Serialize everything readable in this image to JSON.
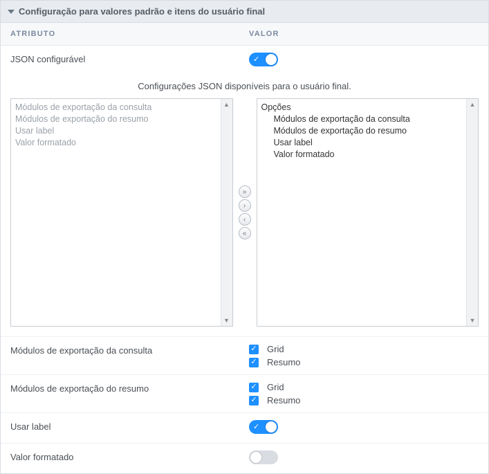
{
  "panel": {
    "title": "Configuração para valores padrão e itens do usuário final",
    "col_attr": "ATRIBUTO",
    "col_val": "VALOR"
  },
  "json_configurable": {
    "label": "JSON configurável",
    "checked": true
  },
  "caption": "Configurações JSON disponíveis para o usuário final.",
  "transfer": {
    "left": [
      "Módulos de exportação da consulta",
      "Módulos de exportação do resumo",
      "Usar label",
      "Valor formatado"
    ],
    "right_header": "Opções",
    "right": [
      "Módulos de exportação da consulta",
      "Módulos de exportação do resumo",
      "Usar label",
      "Valor formatado"
    ]
  },
  "buttons": {
    "move_all_right": "»",
    "move_right": "›",
    "move_left": "‹",
    "move_all_left": "«"
  },
  "modules_consulta": {
    "label": "Módulos de exportação da consulta",
    "opts": [
      {
        "label": "Grid",
        "checked": true
      },
      {
        "label": "Resumo",
        "checked": true
      }
    ]
  },
  "modules_resumo": {
    "label": "Módulos de exportação do resumo",
    "opts": [
      {
        "label": "Grid",
        "checked": true
      },
      {
        "label": "Resumo",
        "checked": true
      }
    ]
  },
  "usar_label": {
    "label": "Usar label",
    "checked": true
  },
  "valor_formatado": {
    "label": "Valor formatado",
    "checked": false
  }
}
